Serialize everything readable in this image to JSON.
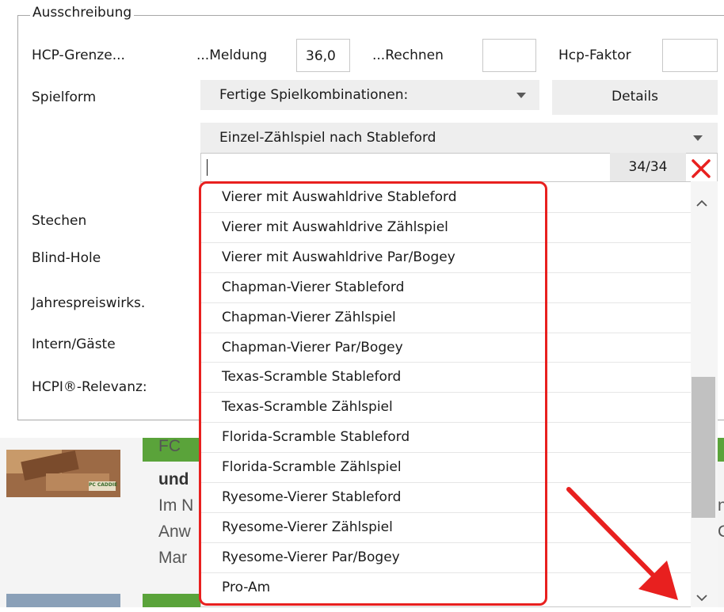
{
  "group": {
    "legend": "Ausschreibung"
  },
  "hcp": {
    "label": "HCP-Grenze...",
    "meldung_label": "...Meldung",
    "meldung_value": "36,0",
    "rechnen_label": "...Rechnen",
    "rechnen_value": "",
    "faktor_label": "Hcp-Faktor",
    "faktor_value": ""
  },
  "spielform": {
    "label": "Spielform",
    "combinations_value": "Fertige Spielkombinationen:",
    "details_button": "Details",
    "mode_value": "Einzel-Zählspiel nach Stableford"
  },
  "side_labels": [
    "Stechen",
    "Blind-Hole",
    "Jahrespreiswirks.",
    "Intern/Gäste",
    "HCPI®-Relevanz:"
  ],
  "search": {
    "value": "",
    "count": "34/34"
  },
  "dropdown_items": [
    "Vierer mit Auswahldrive Stableford",
    "Vierer mit Auswahldrive Zählspiel",
    "Vierer mit Auswahldrive Par/Bogey",
    "Chapman-Vierer Stableford",
    "Chapman-Vierer Zählspiel",
    "Chapman-Vierer Par/Bogey",
    "Texas-Scramble Stableford",
    "Texas-Scramble Zählspiel",
    "Florida-Scramble Stableford",
    "Florida-Scramble Zählspiel",
    "Ryesome-Vierer Stableford",
    "Ryesome-Vierer Zählspiel",
    "Ryesome-Vierer Par/Bogey",
    "Pro-Am"
  ],
  "background_news": {
    "fragments": [
      "FC",
      "und",
      "Im N",
      "Anw",
      "Mar"
    ],
    "right_fragments": [
      "n",
      "C"
    ],
    "thumb_text": "PC CADDIE"
  },
  "colors": {
    "annotation": "#e8201f",
    "close": "#e8201f",
    "news_green": "#5aa33a"
  },
  "icons": {
    "close": "close-icon",
    "scroll_up": "chevron-up-icon",
    "scroll_down": "chevron-down-icon",
    "arrow": "red-arrow-icon"
  }
}
